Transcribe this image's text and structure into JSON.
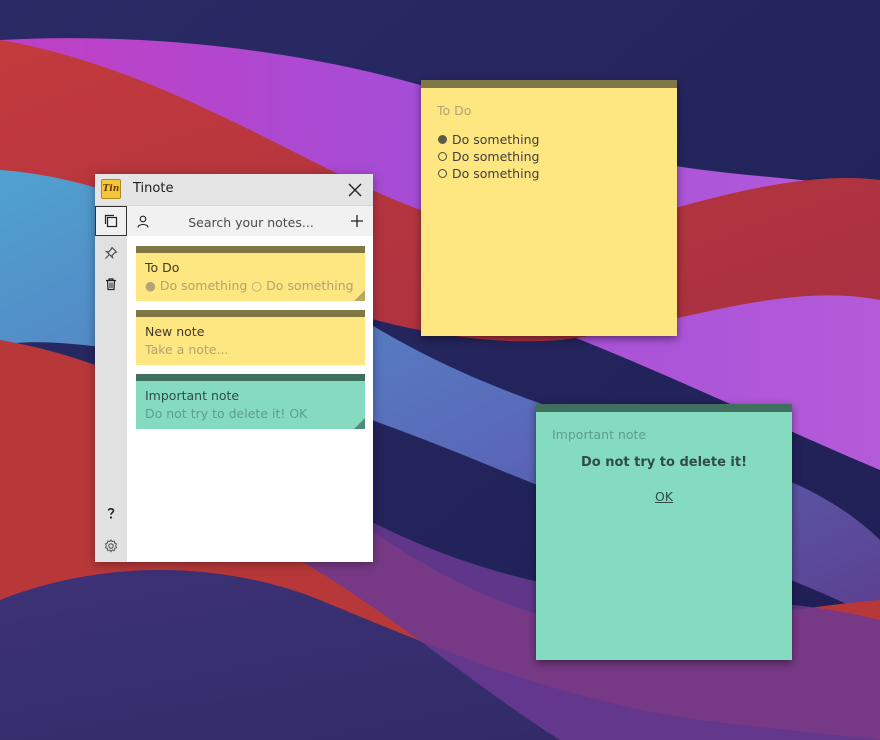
{
  "app": {
    "logo_text": "Tin",
    "title": "Tinote",
    "search_placeholder": "Search your notes..."
  },
  "cards": [
    {
      "title": "To Do",
      "preview": "● Do something ○ Do something ○ Do something",
      "bar_color": "#7f7844",
      "bg_color": "#fee681",
      "title_color": "#3f3b2a",
      "preview_color": "#b1a475",
      "fold_color": "#b7a966",
      "folded": true
    },
    {
      "title": "New note",
      "preview": "Take a note...",
      "bar_color": "#7f7844",
      "bg_color": "#fee681",
      "title_color": "#3f3b2a",
      "preview_color": "#b1a475",
      "fold_color": "",
      "folded": false
    },
    {
      "title": "Important note",
      "preview": "Do not try to delete it!   OK",
      "bar_color": "#3f6f5e",
      "bg_color": "#85dbc0",
      "title_color": "#2f4d43",
      "preview_color": "#5e9f89",
      "fold_color": "#4f8d79",
      "folded": true
    }
  ],
  "todo_note": {
    "title": "To Do",
    "items": [
      {
        "text": "Do something",
        "checked": true
      },
      {
        "text": "Do something",
        "checked": false
      },
      {
        "text": "Do something",
        "checked": false
      }
    ]
  },
  "important_note": {
    "title": "Important note",
    "body": "Do not try to delete it!",
    "link": "OK"
  },
  "icons": {
    "close": "close-icon",
    "notes": "notes-icon",
    "pin": "pin-icon",
    "trash": "trash-icon",
    "help": "help-icon",
    "settings": "gear-icon",
    "user": "user-icon",
    "add": "plus-icon"
  }
}
